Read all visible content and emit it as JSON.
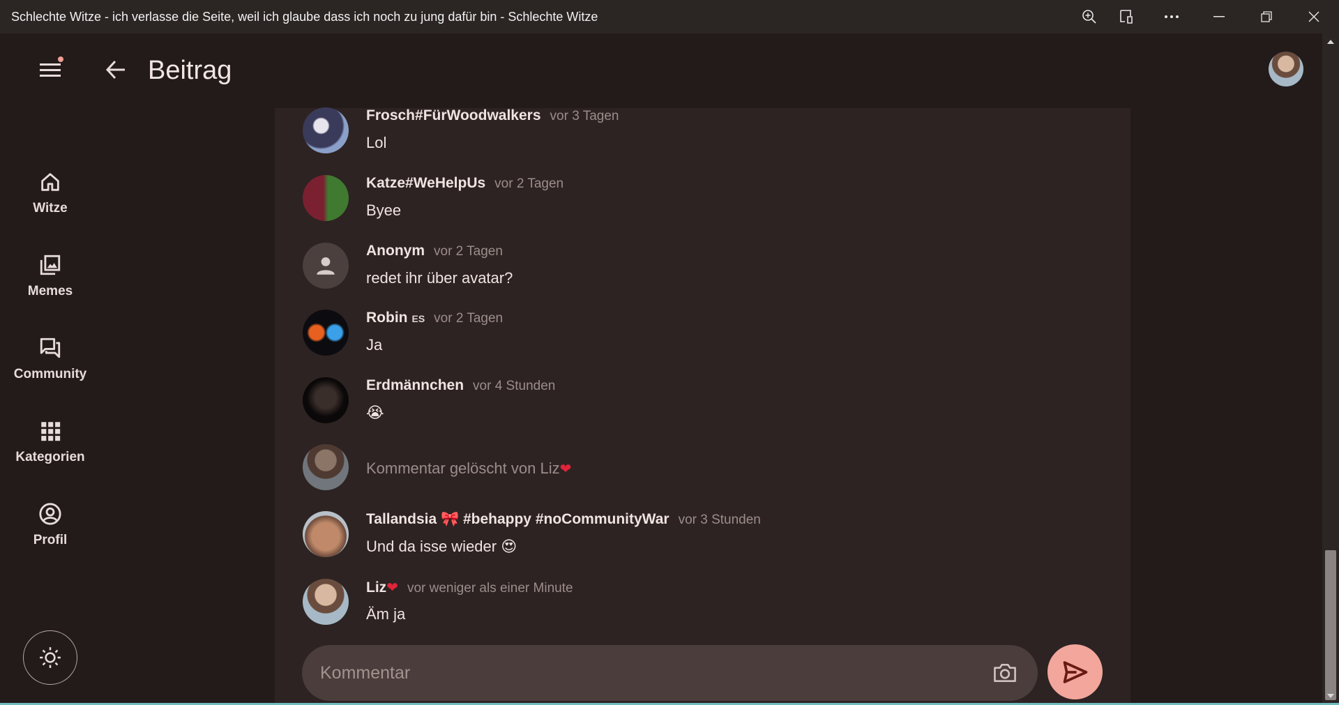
{
  "window": {
    "title": "Schlechte Witze - ich verlasse die Seite, weil ich glaube dass ich noch zu jung dafür bin - Schlechte Witze",
    "buttons": [
      "zoom-icon",
      "read-aloud-icon",
      "more-icon",
      "minimize-icon",
      "restore-icon",
      "close-icon"
    ]
  },
  "header": {
    "title": "Beitrag"
  },
  "nav": {
    "items": [
      {
        "label": "Witze",
        "icon": "home-icon"
      },
      {
        "label": "Memes",
        "icon": "images-icon"
      },
      {
        "label": "Community",
        "icon": "forum-icon"
      },
      {
        "label": "Kategorien",
        "icon": "grid-icon"
      },
      {
        "label": "Profil",
        "icon": "account-circle-icon"
      }
    ],
    "theme_icon": "sun-icon"
  },
  "comments": [
    {
      "name": "Frosch#FürWoodwalkers",
      "tag": "",
      "time": "vor 3 Tagen",
      "text": "Lol"
    },
    {
      "name": "Katze#WeHelpUs",
      "tag": "",
      "time": "vor 2 Tagen",
      "text": "Byee"
    },
    {
      "name": "Anonym",
      "tag": "",
      "time": "vor 2 Tagen",
      "text": "redet ihr über avatar?"
    },
    {
      "name": "Robin",
      "tag": "ES",
      "time": "vor 2 Tagen",
      "text": "Ja"
    },
    {
      "name": "Erdmännchen",
      "tag": "",
      "time": "vor 4 Stunden",
      "text": "😭"
    },
    {
      "deleted_text": "Kommentar gelöscht von Liz",
      "heart": "❤"
    },
    {
      "name": "Tallandsia 🎀 #behappy #noCommunityWar",
      "tag": "",
      "time": "vor 3 Stunden",
      "text": "Und da isse wieder 😍"
    },
    {
      "name": "Liz",
      "heart": "❤",
      "time": "vor weniger als einer Minute",
      "text": "Äm ja"
    }
  ],
  "composer": {
    "placeholder": "Kommentar",
    "camera_icon": "camera-icon",
    "send_icon": "send-icon"
  },
  "colors": {
    "accent": "#f2a69c",
    "background": "#231b1a",
    "panel": "#2d2322",
    "heart": "#e0243a"
  }
}
